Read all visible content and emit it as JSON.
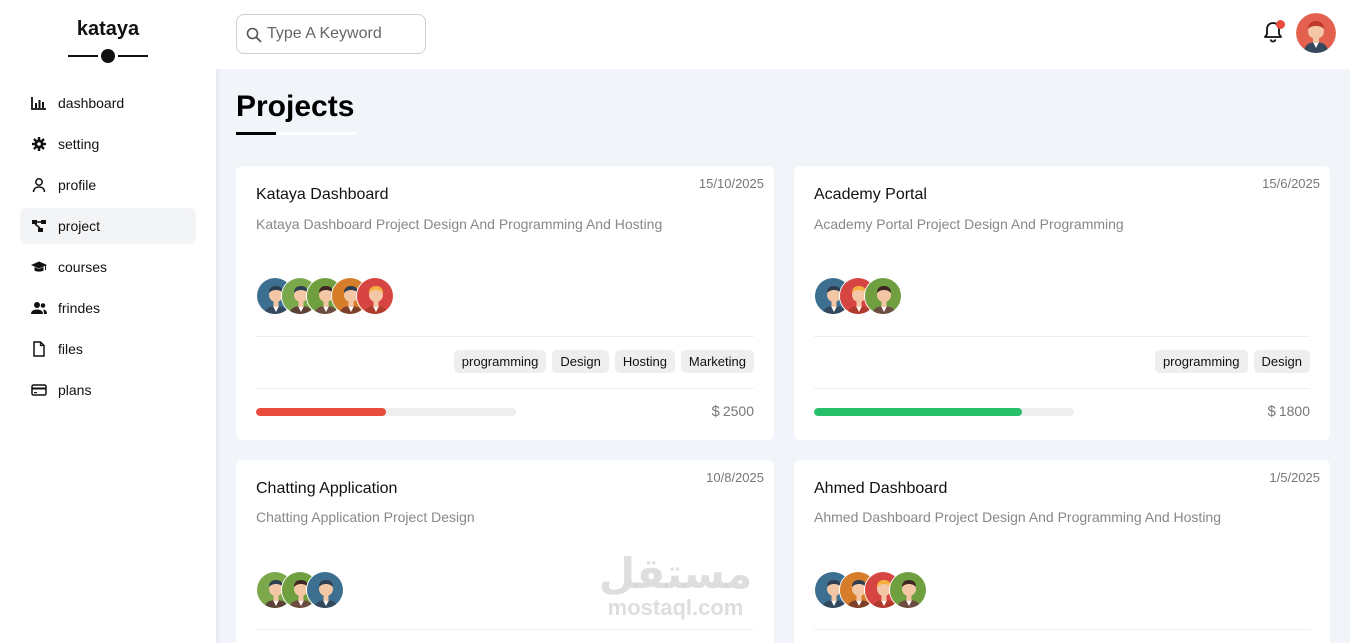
{
  "brand": {
    "name": "kataya"
  },
  "sidebar": {
    "items": [
      {
        "label": "dashboard",
        "icon": "chart-icon",
        "active": false
      },
      {
        "label": "setting",
        "icon": "gear-icon",
        "active": false
      },
      {
        "label": "profile",
        "icon": "user-icon",
        "active": false
      },
      {
        "label": "project",
        "icon": "diagram-icon",
        "active": true
      },
      {
        "label": "courses",
        "icon": "graduation-cap-icon",
        "active": false
      },
      {
        "label": "frindes",
        "icon": "users-icon",
        "active": false
      },
      {
        "label": "files",
        "icon": "file-icon",
        "active": false
      },
      {
        "label": "plans",
        "icon": "credit-card-icon",
        "active": false
      }
    ]
  },
  "header": {
    "search": {
      "placeholder": "Type A Keyword",
      "value": ""
    },
    "notification_icon": "bell-icon",
    "notification_badge_color": "#e74c3c"
  },
  "page": {
    "title": "Projects"
  },
  "projects": [
    {
      "title": "Kataya Dashboard",
      "description": "Kataya Dashboard Project Design And Programming And Hosting",
      "date": "15/10/2025",
      "team_size": 5,
      "tags": [
        "programming",
        "Design",
        "Hosting",
        "Marketing"
      ],
      "progress": 0.5,
      "progress_color": "#e74c3c",
      "currency": "$",
      "price": "2500"
    },
    {
      "title": "Academy Portal",
      "description": "Academy Portal Project Design And Programming",
      "date": "15/6/2025",
      "team_size": 3,
      "tags": [
        "programming",
        "Design"
      ],
      "progress": 0.8,
      "progress_color": "#27c06a",
      "currency": "$",
      "price": "1800"
    },
    {
      "title": "Chatting Application",
      "description": "Chatting Application Project Design",
      "date": "10/8/2025",
      "team_size": 3
    },
    {
      "title": "Ahmed Dashboard",
      "description": "Ahmed Dashboard Project Design And Programming And Hosting",
      "date": "1/5/2025",
      "team_size": 4
    }
  ],
  "watermark": {
    "arabic": "مستقل",
    "latin": "mostaql.com"
  }
}
